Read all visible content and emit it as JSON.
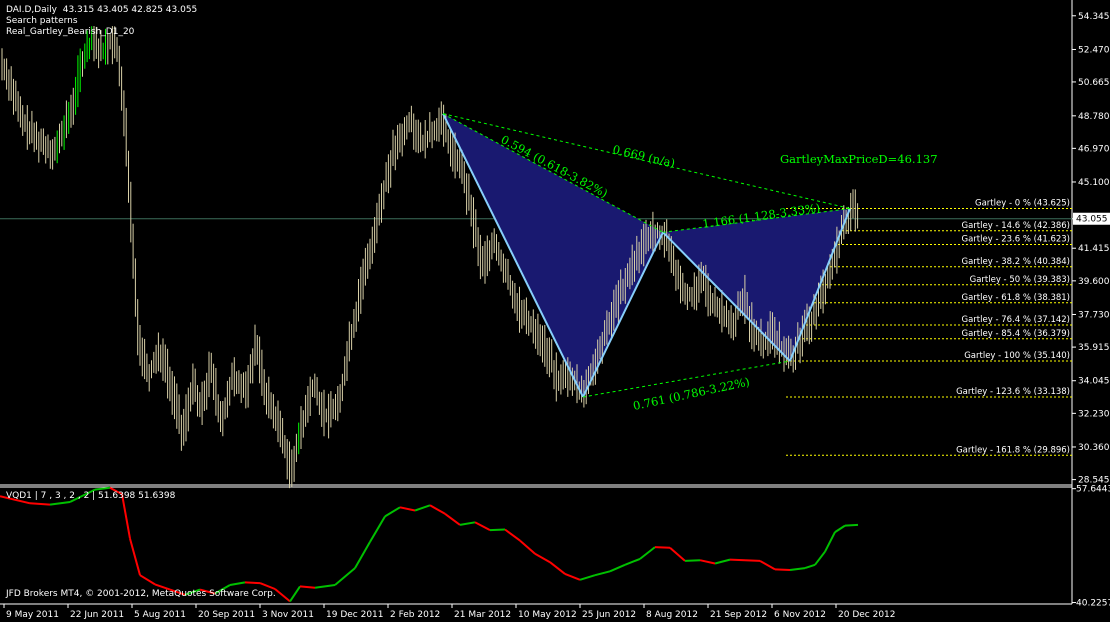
{
  "header": {
    "line1": "DAI.D,Daily  43.315 43.405 42.825 43.055",
    "line2": "Search patterns",
    "line3": "Real_Gartley_Bearish_D1_20"
  },
  "indicator": {
    "label": "VQD1 | 7 , 3 , 2 , 2 | 51.6398 51.6398"
  },
  "copyright": "JFD Brokers MT4, © 2001-2012, MetaQuotes Software Corp.",
  "colors": {
    "background": "#000000",
    "axis": "#ffffff",
    "candles": "#d8d0a8",
    "candles_up": "#00ff00",
    "pattern_fill": "#191970",
    "pattern_line": "#87cefa",
    "fib_line": "#ffff00",
    "annotation": "#00ff00",
    "vqd_up": "#00c000",
    "vqd_down": "#ff0000"
  },
  "chart_data": [
    {
      "type": "candlestick",
      "title": "DAI.D,Daily",
      "price_axis": {
        "ticks": [
          54.345,
          52.47,
          50.665,
          48.78,
          46.97,
          45.1,
          43.055,
          41.415,
          39.6,
          37.73,
          35.915,
          34.045,
          32.23,
          30.36,
          28.545
        ],
        "current_price": 43.055,
        "range": [
          28.3,
          55.0
        ]
      },
      "time_axis": {
        "labels": [
          "9 May 2011",
          "22 Jun 2011",
          "5 Aug 2011",
          "20 Sep 2011",
          "3 Nov 2011",
          "19 Dec 2011",
          "2 Feb 2012",
          "21 Mar 2012",
          "10 May 2012",
          "25 Jun 2012",
          "8 Aug 2012",
          "21 Sep 2012",
          "6 Nov 2012",
          "20 Dec 2012"
        ]
      },
      "price_path": [
        [
          0,
          51.8
        ],
        [
          9,
          50.7
        ],
        [
          20,
          48.6
        ],
        [
          35,
          47.5
        ],
        [
          55,
          46.8
        ],
        [
          70,
          49.0
        ],
        [
          82,
          52.0
        ],
        [
          92,
          53.1
        ],
        [
          100,
          52.3
        ],
        [
          110,
          53.0
        ],
        [
          118,
          52.0
        ],
        [
          125,
          47.5
        ],
        [
          132,
          41.0
        ],
        [
          138,
          36.2
        ],
        [
          148,
          34.4
        ],
        [
          160,
          35.8
        ],
        [
          172,
          33.2
        ],
        [
          182,
          31.2
        ],
        [
          192,
          34.0
        ],
        [
          200,
          32.3
        ],
        [
          210,
          34.8
        ],
        [
          220,
          31.6
        ],
        [
          232,
          34.4
        ],
        [
          245,
          33.5
        ],
        [
          255,
          36.0
        ],
        [
          265,
          33.3
        ],
        [
          278,
          31.6
        ],
        [
          290,
          29.1
        ],
        [
          300,
          31.4
        ],
        [
          312,
          33.8
        ],
        [
          325,
          31.9
        ],
        [
          340,
          33.4
        ],
        [
          350,
          36.4
        ],
        [
          362,
          39.6
        ],
        [
          378,
          43.5
        ],
        [
          392,
          46.8
        ],
        [
          402,
          47.5
        ],
        [
          410,
          48.6
        ],
        [
          420,
          47.1
        ],
        [
          430,
          47.8
        ],
        [
          440,
          48.5
        ],
        [
          450,
          47.0
        ],
        [
          462,
          45.6
        ],
        [
          472,
          43.0
        ],
        [
          482,
          40.3
        ],
        [
          492,
          41.9
        ],
        [
          505,
          40.0
        ],
        [
          520,
          37.8
        ],
        [
          535,
          36.9
        ],
        [
          548,
          35.4
        ],
        [
          558,
          33.8
        ],
        [
          570,
          34.4
        ],
        [
          582,
          33.2
        ],
        [
          592,
          34.8
        ],
        [
          605,
          36.8
        ],
        [
          620,
          39.0
        ],
        [
          632,
          40.6
        ],
        [
          645,
          41.9
        ],
        [
          655,
          42.4
        ],
        [
          663,
          42.3
        ],
        [
          672,
          40.7
        ],
        [
          682,
          39.0
        ],
        [
          692,
          38.7
        ],
        [
          702,
          39.6
        ],
        [
          712,
          38.2
        ],
        [
          722,
          37.9
        ],
        [
          732,
          37.1
        ],
        [
          742,
          38.9
        ],
        [
          752,
          36.8
        ],
        [
          762,
          36.2
        ],
        [
          772,
          36.9
        ],
        [
          780,
          35.8
        ],
        [
          790,
          35.14
        ],
        [
          800,
          36.5
        ],
        [
          812,
          37.6
        ],
        [
          822,
          39.1
        ],
        [
          832,
          40.6
        ],
        [
          840,
          42.2
        ],
        [
          848,
          43.4
        ],
        [
          856,
          43.6
        ]
      ],
      "pattern": {
        "name": "Real_Gartley_Bearish_D1_20",
        "points": [
          [
            443,
            48.9
          ],
          [
            583,
            33.14
          ],
          [
            663,
            42.3
          ],
          [
            790,
            35.14
          ],
          [
            850,
            43.625
          ]
        ],
        "labels": [
          {
            "text": "0.594 (0.618-3.82%)",
            "on": "XA"
          },
          {
            "text": "0.669 (n/a)",
            "on": "XD"
          },
          {
            "text": "1.166 (1.128-3.33%)",
            "on": "BD"
          },
          {
            "text": "0.761 (0.786-3.22%)",
            "on": "AC"
          },
          {
            "text": "GartleyMaxPriceD=46.137",
            "on": "D"
          }
        ]
      },
      "fib_levels": [
        {
          "label": "Gartley - 0 % (43.625)",
          "price": 43.625
        },
        {
          "label": "Gartley - 14.6 % (42.386)",
          "price": 42.386
        },
        {
          "label": "Gartley - 23.6 % (41.623)",
          "price": 41.623
        },
        {
          "label": "Gartley - 38.2 % (40.384)",
          "price": 40.384
        },
        {
          "label": "Gartley - 50 % (39.383)",
          "price": 39.383
        },
        {
          "label": "Gartley - 61.8 % (38.381)",
          "price": 38.381
        },
        {
          "label": "Gartley - 76.4 % (37.142)",
          "price": 37.142
        },
        {
          "label": "Gartley - 85.4 % (36.379)",
          "price": 36.379
        },
        {
          "label": "Gartley - 100 % (35.140)",
          "price": 35.14
        },
        {
          "label": "Gartley - 123.6 % (33.138)",
          "price": 33.138
        },
        {
          "label": "Gartley - 161.8 % (29.896)",
          "price": 29.896
        }
      ]
    },
    {
      "type": "line",
      "title": "VQD1",
      "axis": {
        "ticks": [
          57.6443,
          40.2257
        ],
        "range": [
          40.0,
          57.9
        ]
      },
      "series": [
        {
          "x": [
            0,
            30,
            50,
            70,
            95,
            110,
            122,
            130,
            140,
            155,
            170,
            185,
            200,
            215,
            230,
            245,
            260,
            275,
            290,
            300,
            315,
            335,
            355,
            370,
            385,
            400,
            415,
            430,
            445,
            460,
            475,
            490,
            505,
            520,
            535,
            550,
            565,
            580,
            595,
            610,
            625,
            640,
            655,
            670,
            685,
            700,
            715,
            730,
            745,
            760,
            775,
            790,
            805,
            815,
            825,
            835,
            845,
            858
          ],
          "y": [
            56.5,
            55.4,
            55.2,
            55.6,
            57.5,
            57.8,
            56.8,
            50.0,
            44.4,
            43.0,
            42.2,
            41.4,
            42.2,
            41.6,
            42.9,
            43.3,
            43.2,
            42.3,
            40.4,
            42.7,
            42.5,
            42.9,
            45.5,
            49.5,
            53.4,
            54.8,
            54.3,
            55.1,
            53.8,
            52.1,
            52.5,
            51.3,
            51.4,
            49.7,
            47.7,
            46.4,
            44.6,
            43.7,
            44.4,
            45.0,
            46.0,
            46.9,
            48.7,
            48.6,
            46.6,
            46.7,
            46.2,
            46.8,
            46.7,
            46.6,
            45.3,
            45.2,
            45.5,
            46.0,
            48.0,
            51.0,
            52.0,
            52.1
          ]
        }
      ]
    }
  ]
}
